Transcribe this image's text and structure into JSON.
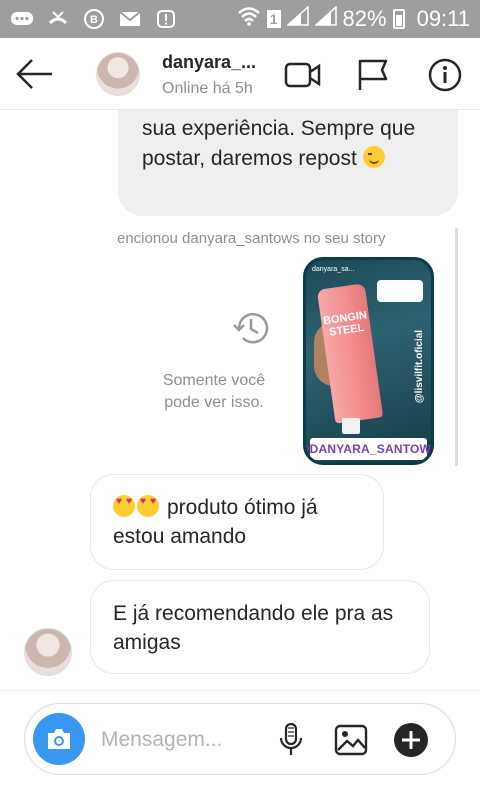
{
  "status_bar": {
    "battery": "82%",
    "time": "09:11",
    "sim": "1"
  },
  "header": {
    "username": "danyara_...",
    "status": "Online há 5h"
  },
  "messages": {
    "outgoing_text": "sua experiência. Sempre que postar, daremos repost",
    "mention_text": "encionou danyara_santows no seu story",
    "hidden_text": "Somente você pode ver isso.",
    "story_tag": "@DANYARA_SANTOWS",
    "story_handle": "@lisvilfit.oficial",
    "story_user": "danyara_sa...",
    "story_product": "BONGIN STEEL",
    "incoming_1": "produto ótimo já estou amando",
    "incoming_2": "E já recomendando ele pra as amigas"
  },
  "composer": {
    "placeholder": "Mensagem..."
  },
  "colors": {
    "accent": "#3897f0",
    "status_bar": "#9e9e9e"
  }
}
